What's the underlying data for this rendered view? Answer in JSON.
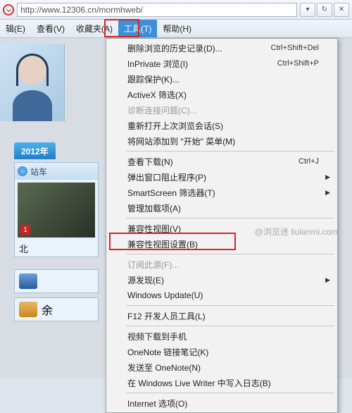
{
  "address": {
    "url": "http://www.12306.cn/mormhweb/"
  },
  "menubar": {
    "edit": "辑(E)",
    "view": "查看(V)",
    "favorites": "收藏夹(A)",
    "tools": "工具(T)",
    "help": "帮助(H)"
  },
  "page": {
    "year_tab": "2012年",
    "station_header": "站车",
    "thumb_badge": "1",
    "thumb_caption": "北",
    "extra_label": "余"
  },
  "dropdown": {
    "delete_history": "删除浏览的历史记录(D)...",
    "delete_history_sc": "Ctrl+Shift+Del",
    "inprivate": "InPrivate 浏览(I)",
    "inprivate_sc": "Ctrl+Shift+P",
    "tracking": "跟踪保护(K)...",
    "activex": "ActiveX 筛选(X)",
    "diagnose": "诊断连接问题(C)...",
    "reopen": "重新打开上次浏览会话(S)",
    "add_start": "将网站添加到 \"开始\" 菜单(M)",
    "view_downloads": "查看下载(N)",
    "view_downloads_sc": "Ctrl+J",
    "popup": "弹出窗口阻止程序(P)",
    "smartscreen": "SmartScreen 筛选器(T)",
    "addons": "管理加载项(A)",
    "compat_view": "兼容性视图(V)",
    "compat_settings": "兼容性视图设置(B)",
    "feed": "订阅此源(F)...",
    "feed_discovery": "源发现(E)",
    "win_update": "Windows Update(U)",
    "f12": "F12 开发人员工具(L)",
    "video_mobile": "视频下载到手机",
    "onenote_link": "OneNote 链接笔记(K)",
    "onenote_send": "发送至 OneNote(N)",
    "wlw": "在 Windows Live Writer 中写入日志(B)",
    "internet_options": "Internet 选项(O)"
  },
  "watermark": "@浏览迷 liulanmi.com"
}
